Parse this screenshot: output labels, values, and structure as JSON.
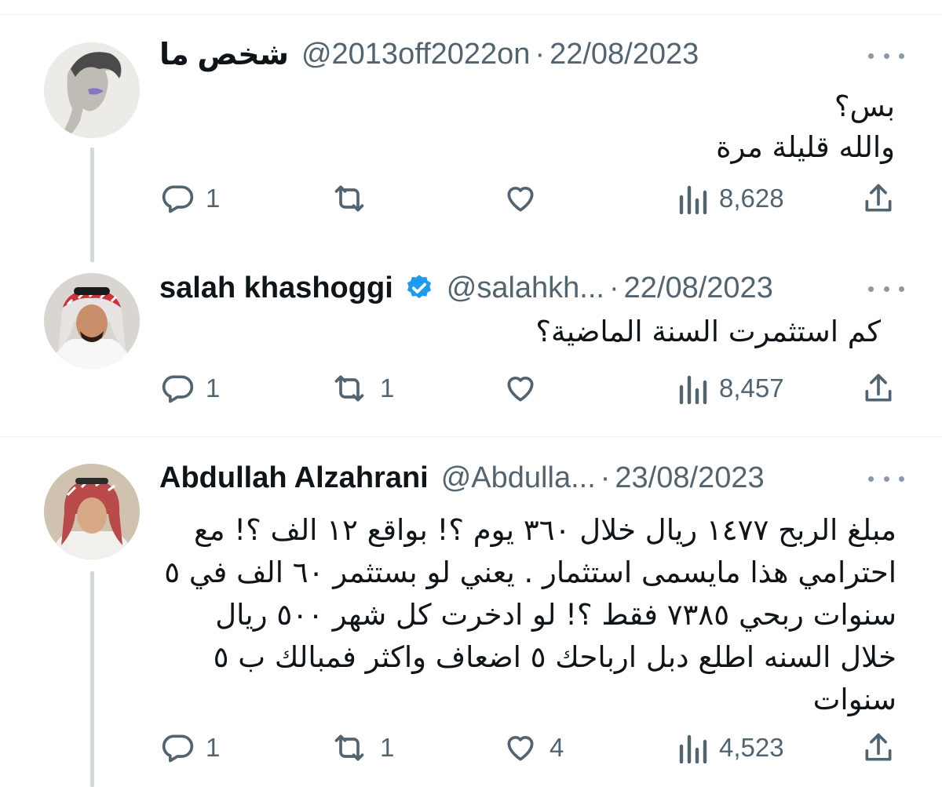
{
  "tweets": [
    {
      "name": "شخص ما",
      "handle": "@2013off2022on",
      "separator": "·",
      "date": "22/08/2023",
      "verified": false,
      "text_lines": [
        "بس؟",
        "والله قليلة مرة"
      ],
      "replies": "1",
      "retweets": "",
      "likes": "",
      "views": "8,628"
    },
    {
      "name": "salah khashoggi",
      "handle": "@salahkh...",
      "separator": "·",
      "date": "22/08/2023",
      "verified": true,
      "text_lines": [
        "كم استثمرت السنة الماضية؟"
      ],
      "replies": "1",
      "retweets": "1",
      "likes": "",
      "views": "8,457"
    },
    {
      "name": "Abdullah Alzahrani",
      "handle": "@Abdulla...",
      "separator": "·",
      "date": "23/08/2023",
      "verified": false,
      "text_lines": [
        "مبلغ الربح ١٤٧٧ ريال خلال ٣٦٠ يوم ؟! بواقع ١٢ الف ؟! مع",
        "احترامي هذا مايسمى استثمار . يعني لو بستثمر ٦٠ الف في ٥",
        "سنوات ربحي ٧٣٨٥ فقط ؟! لو ادخرت كل شهر ٥٠٠ ريال",
        "خلال السنه اطلع دبل ارباحك ٥ اضعاف واكثر فمبالك ب ٥",
        "سنوات"
      ],
      "replies": "1",
      "retweets": "1",
      "likes": "4",
      "views": "4,523"
    }
  ],
  "icons": {
    "reply": "reply-icon",
    "retweet": "retweet-icon",
    "like": "heart-icon",
    "views": "views-icon",
    "share": "share-icon",
    "more": "more-icon",
    "verified": "verified-badge-icon"
  },
  "colors": {
    "text": "#0f1419",
    "secondary": "#536471",
    "verified": "#1d9bf0",
    "thread_line": "#cfd9de"
  }
}
